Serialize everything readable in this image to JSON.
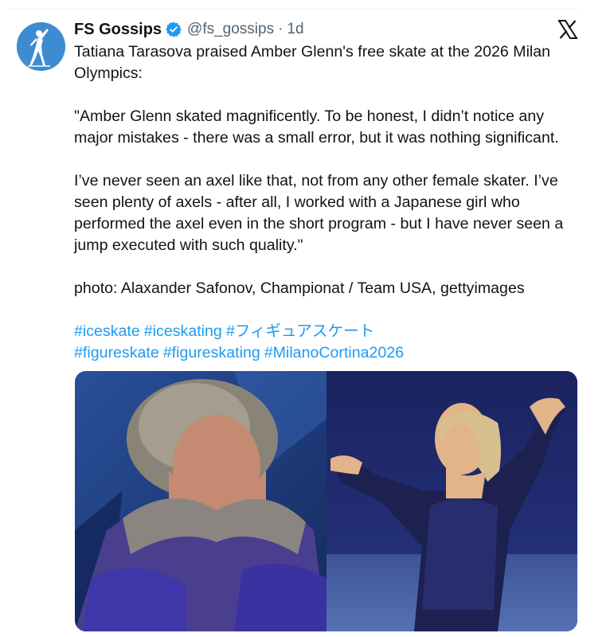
{
  "tweet": {
    "author": {
      "display_name": "FS Gossips",
      "handle": "@fs_gossips",
      "separator": "·",
      "time_ago": "1d",
      "avatar_icon": "figure-skater-silhouette-icon",
      "verified_icon": "verified-badge-icon"
    },
    "platform_icon": "x-logo-icon",
    "text_lines": {
      "p1": "Tatiana Tarasova praised Amber Glenn's free skate at the 2026 Milan Olympics:",
      "p2": "\"Amber Glenn skated magnificently. To be honest, I didn’t notice any major mistakes - there was a small error, but it was nothing significant.",
      "p3": "I’ve never seen an axel like that, not from any other female skater. I’ve seen plenty of axels - after all, I worked with a Japanese girl who performed the axel even in the short program - but I have never seen a jump executed with such quality.\"",
      "p4": "photo: Alaxander Safonov, Championat / Team USA, gettyimages"
    },
    "hashtags": [
      "#iceskate",
      "#iceskating",
      "#フィギュアスケート",
      "#figureskate",
      "#figureskating",
      "#MilanoCortina2026"
    ],
    "media": [
      {
        "name": "photo-tarasova"
      },
      {
        "name": "photo-amber-glenn"
      }
    ]
  },
  "colors": {
    "text": "#0f1419",
    "secondary": "#536471",
    "link": "#1d9bf0",
    "avatar_bg": "#3d8bd1",
    "verified": "#1d9bf0"
  }
}
